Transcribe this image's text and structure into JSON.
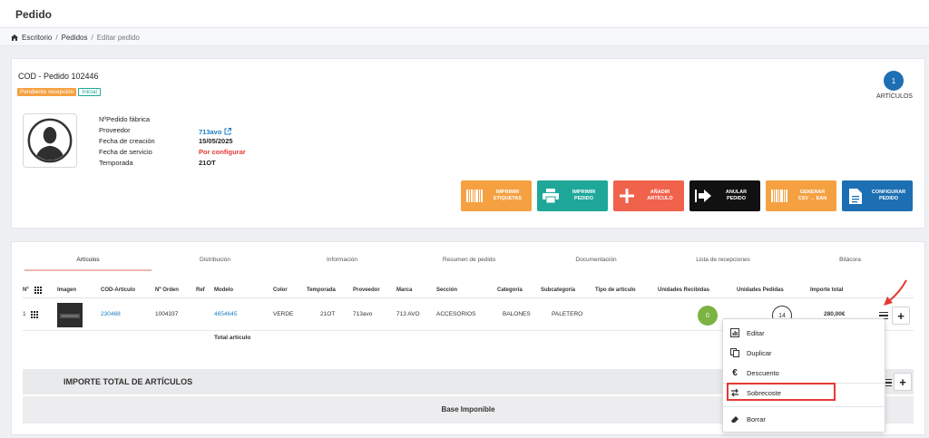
{
  "header": {
    "title": "Pedido"
  },
  "breadcrumb": {
    "home": "Escritorio",
    "sep1": "/",
    "orders": "Pedidos",
    "sep2": "/",
    "current": "Editar pedido"
  },
  "order": {
    "title": "COD - Pedido 102446",
    "badge_status": "Pendiente recepción",
    "badge_state": "Inicial",
    "articles_count": "1",
    "articles_label": "ARTÍCULOS",
    "fields": {
      "factory_label": "NºPedido fábrica",
      "supplier_label": "Proveedor",
      "supplier_value": "713avo",
      "created_label": "Fecha de creación",
      "created_value": "15/05/2025",
      "service_label": "Fecha de servicio",
      "service_value": "Por configurar",
      "season_label": "Temporada",
      "season_value": "21OT"
    }
  },
  "actions": [
    {
      "line1": "IMPRIMIR",
      "line2": "ETIQUETAS",
      "color": "#f5a142"
    },
    {
      "line1": "IMPRIMIR",
      "line2": "PEDIDO",
      "color": "#1fa89a"
    },
    {
      "line1": "AÑADIR",
      "line2": "ARTÍCULO",
      "color": "#f0624b"
    },
    {
      "line1": "ANULAR",
      "line2": "PEDIDO",
      "color": "#111111"
    },
    {
      "line1": "GENERAR",
      "line2": "CSV → EAN",
      "color": "#f5a142"
    },
    {
      "line1": "CONFIGURAR",
      "line2": "PEDIDO",
      "color": "#1d6fb3"
    }
  ],
  "tabs": [
    "Artículos",
    "Distribución",
    "Información",
    "Resumen de pedido",
    "Documentación",
    "Lista de recepciones",
    "Bitácora"
  ],
  "table": {
    "headers": {
      "num": "Nº",
      "image": "Imagen",
      "cod": "COD-Artículo",
      "order": "Nº Orden",
      "ref": "Ref",
      "model": "Modelo",
      "color": "Color",
      "season": "Temporada",
      "supplier": "Proveedor",
      "brand": "Marca",
      "section": "Sección",
      "category": "Categoría",
      "subcategory": "Subcategoría",
      "type": "Tipo de artículo",
      "received": "Unidades Recibidas",
      "ordered": "Unidades Pedidas",
      "amount": "Importe total"
    },
    "row": {
      "num": "1",
      "cod": "230468",
      "order": "1004337",
      "model": "4654645",
      "color": "VERDE",
      "season": "21OT",
      "supplier": "713avo",
      "brand": "713 AVO",
      "section": "ACCESORIOS",
      "category": "BALONES",
      "subcategory": "PALETERO",
      "received": "0",
      "ordered": "14",
      "amount": "280,00€"
    },
    "total_label": "Total artículo"
  },
  "totals": {
    "title": "IMPORTE TOTAL DE ARTÍCULOS",
    "base": "Base Imponible"
  },
  "menu": {
    "edit": "Editar",
    "duplicate": "Duplicar",
    "discount": "Descuento",
    "surcharge": "Sobrecoste",
    "delete": "Borrar"
  }
}
